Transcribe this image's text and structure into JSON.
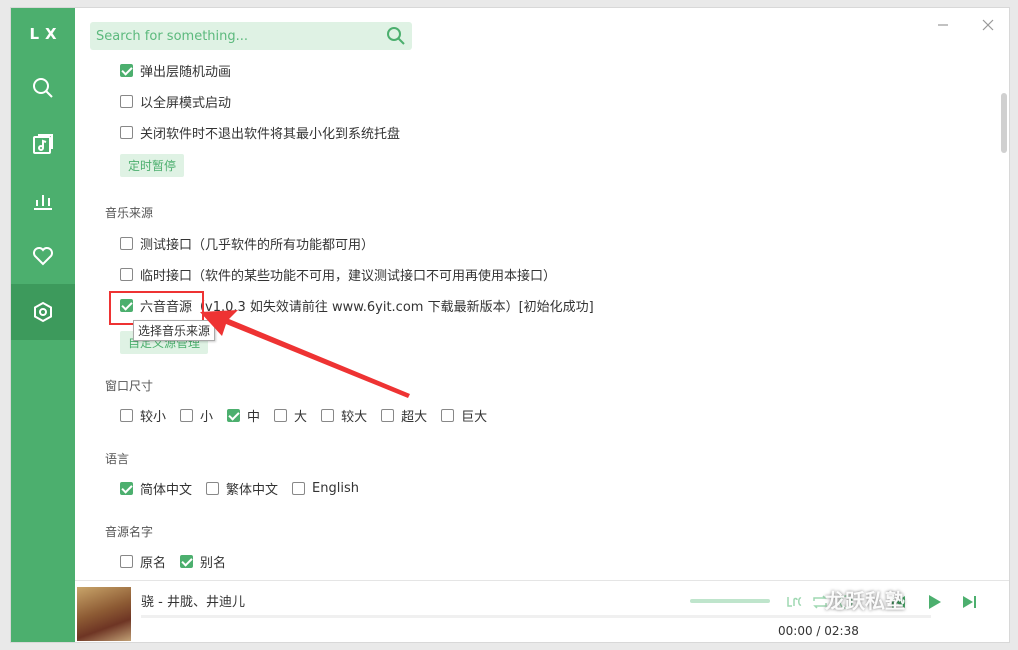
{
  "app": {
    "logo": "LX"
  },
  "search": {
    "placeholder": "Search for something..."
  },
  "nav": [
    "search-icon",
    "music-list-icon",
    "chart-icon",
    "heart-icon",
    "settings-icon"
  ],
  "settings": {
    "top_options": [
      {
        "label": "弹出层随机动画",
        "checked": true
      },
      {
        "label": "以全屏模式启动",
        "checked": false
      },
      {
        "label": "关闭软件时不退出软件将其最小化到系统托盘",
        "checked": false
      }
    ],
    "timer_button": "定时暂停",
    "music_source": {
      "title": "音乐来源",
      "options": [
        {
          "label": "测试接口（几乎软件的所有功能都可用）",
          "checked": false
        },
        {
          "label": "临时接口（软件的某些功能不可用，建议测试接口不可用再使用本接口）",
          "checked": false
        },
        {
          "label": "六音音源（v1.0.3 如失效请前往 www.6yit.com 下载最新版本）[初始化成功]",
          "checked": true
        }
      ],
      "custom_button": "自定义源管理",
      "tooltip": "选择音乐来源"
    },
    "window_size": {
      "title": "窗口尺寸",
      "options": [
        {
          "label": "较小",
          "checked": false
        },
        {
          "label": "小",
          "checked": false
        },
        {
          "label": "中",
          "checked": true
        },
        {
          "label": "大",
          "checked": false
        },
        {
          "label": "较大",
          "checked": false
        },
        {
          "label": "超大",
          "checked": false
        },
        {
          "label": "巨大",
          "checked": false
        }
      ]
    },
    "language": {
      "title": "语言",
      "options": [
        {
          "label": "简体中文",
          "checked": true
        },
        {
          "label": "繁体中文",
          "checked": false
        },
        {
          "label": "English",
          "checked": false
        }
      ]
    },
    "source_name": {
      "title": "音源名字",
      "options": [
        {
          "label": "原名",
          "checked": false
        },
        {
          "label": "别名",
          "checked": true
        }
      ]
    }
  },
  "player": {
    "song": "骁 - 井胧、井迪儿",
    "time": "00:00 / 02:38",
    "progress": 0
  },
  "watermark": "龙跃私塾",
  "colors": {
    "accent": "#4caf6e",
    "annotation": "#e33333"
  }
}
